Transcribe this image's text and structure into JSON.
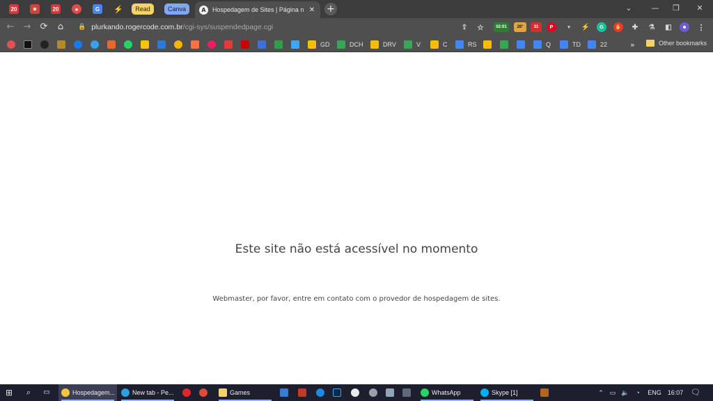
{
  "browser": {
    "pinned_tabs": [
      {
        "icon": "news-icon",
        "text": "20",
        "color": "#d23b3b"
      },
      {
        "icon": "feed-icon",
        "text": "",
        "color": "#c9443a"
      },
      {
        "icon": "news-icon",
        "text": "20",
        "color": "#d23b3b"
      },
      {
        "icon": "app-icon",
        "text": "",
        "color": "#e04c4c"
      },
      {
        "icon": "translate-icon",
        "text": "",
        "color": "#4a86e8"
      },
      {
        "icon": "bolt-icon",
        "text": "⚡",
        "color": "#5a5a5a"
      }
    ],
    "tab_groups": [
      {
        "label": "Read",
        "color": "#f5d36a"
      },
      {
        "label": "Canva",
        "color": "#7fa8ef"
      }
    ],
    "active_tab": {
      "title": "Hospedagem de Sites | Página n",
      "favicon": "angular-icon"
    },
    "new_tab_label": "+",
    "window_controls": {
      "menu": "⌄",
      "minimize": "—",
      "restore": "❐",
      "close": "✕"
    }
  },
  "toolbar": {
    "back": "←",
    "forward": "→",
    "reload": "⟳",
    "home": "⌂",
    "url_host": "plurkando.rogercode.com.br",
    "url_path": "/cgi-sys/suspendedpage.cgi",
    "extension_badges": {
      "timer": "02:01",
      "weather": "28°",
      "alerts": "31"
    },
    "accent": "#4f4f4f"
  },
  "bookmarks": {
    "items": [
      {
        "label": "GD"
      },
      {
        "label": "DCH"
      },
      {
        "label": "DRV"
      },
      {
        "label": "V"
      },
      {
        "label": "C"
      },
      {
        "label": "RS"
      },
      {
        "label": "Q"
      },
      {
        "label": "TD"
      },
      {
        "label": "22"
      }
    ],
    "overflow": "»",
    "other": "Other bookmarks"
  },
  "page": {
    "heading": "Este site não está acessível no momento",
    "message": "Webmaster, por favor, entre em contato com o provedor de hospedagem de sites."
  },
  "taskbar": {
    "items": [
      {
        "label": "Hospedagem..."
      },
      {
        "label": "New tab - Pe..."
      },
      {
        "label": "Games"
      },
      {
        "label": "WhatsApp"
      },
      {
        "label": "Skype [1]"
      }
    ],
    "language": "ENG",
    "time": "16:07"
  }
}
